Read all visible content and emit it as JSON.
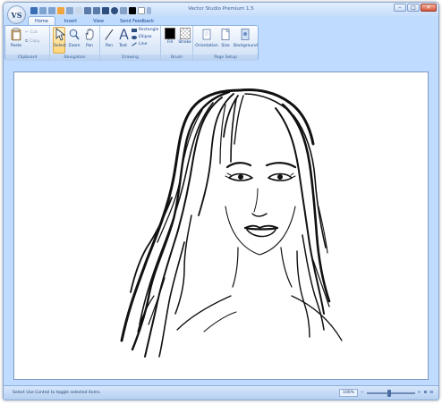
{
  "window": {
    "title": "Vector Studio Premium 1.5"
  },
  "app_button": {
    "logo": "VS"
  },
  "tabs": [
    "Home",
    "Insert",
    "View",
    "Send Feedback"
  ],
  "clipboard": {
    "paste": "Paste",
    "cut": "Cut",
    "copy": "Copy",
    "label": "Clipboard"
  },
  "navigation": {
    "select": "Select",
    "zoom": "Zoom",
    "pan": "Pan",
    "label": "Navigation"
  },
  "drawing": {
    "pen": "Pen",
    "text": "Text",
    "rectangle": "Rectangle",
    "ellipse": "Ellipse",
    "line": "Line",
    "label": "Drawing"
  },
  "brush": {
    "fill": "Fill",
    "stroke": "Stroke",
    "label": "Brush"
  },
  "page_setup": {
    "orientation": "Orientation",
    "size": "Size",
    "background": "Background",
    "label": "Page Setup"
  },
  "status": {
    "text": "Select Use Control to toggle selected items.",
    "zoom": "100%"
  },
  "colors": {
    "accent": "#15428b",
    "ribbon_bg": "#dde9f9",
    "selected": "#ffd67a"
  }
}
